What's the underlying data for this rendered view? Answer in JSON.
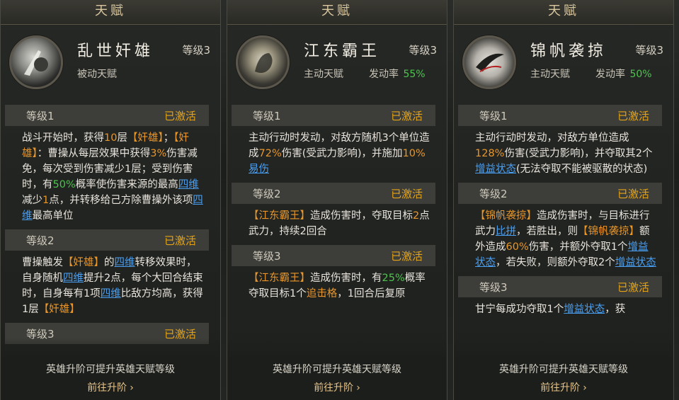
{
  "cards": [
    {
      "header": "天赋",
      "name": "乱世奸雄",
      "level": "等级3",
      "type": "被动天赋",
      "trigger_label": "",
      "trigger_value": "",
      "sections": [
        {
          "label": "等级1",
          "status": "已激活"
        },
        {
          "label": "等级2",
          "status": "已激活"
        },
        {
          "label": "等级3",
          "status": "已激活"
        }
      ],
      "footer_note": "英雄升阶可提升英雄天赋等级",
      "goto_label": "前往升阶"
    },
    {
      "header": "天赋",
      "name": "江东霸王",
      "level": "等级3",
      "type": "主动天赋",
      "trigger_label": "发动率",
      "trigger_value": "55%",
      "sections": [
        {
          "label": "等级1",
          "status": "已激活"
        },
        {
          "label": "等级2",
          "status": "已激活"
        },
        {
          "label": "等级3",
          "status": "已激活"
        }
      ],
      "footer_note": "英雄升阶可提升英雄天赋等级",
      "goto_label": "前往升阶"
    },
    {
      "header": "天赋",
      "name": "锦帆袭掠",
      "level": "等级3",
      "type": "主动天赋",
      "trigger_label": "发动率",
      "trigger_value": "50%",
      "sections": [
        {
          "label": "等级1",
          "status": "已激活"
        },
        {
          "label": "等级2",
          "status": "已激活"
        },
        {
          "label": "等级3",
          "status": "已激活"
        }
      ],
      "footer_note": "英雄升阶可提升英雄天赋等级",
      "goto_label": "前往升阶"
    }
  ],
  "text": {
    "c1": {
      "l1": [
        {
          "t": "战斗开始时，获得"
        },
        {
          "t": "10",
          "c": "orange"
        },
        {
          "t": "层"
        },
        {
          "t": "【奸雄】",
          "c": "orange"
        },
        {
          "t": "；"
        },
        {
          "t": "【奸雄】",
          "c": "orange"
        },
        {
          "t": "：曹操从每层效果中获得"
        },
        {
          "t": "3%",
          "c": "orange"
        },
        {
          "t": "伤害减免，每次受到伤害减少1层；受到伤害时，有"
        },
        {
          "t": "50%",
          "c": "green"
        },
        {
          "t": "概率使伤害来源的最高"
        },
        {
          "t": "四维",
          "c": "blue"
        },
        {
          "t": "减少"
        },
        {
          "t": "1",
          "c": "orange"
        },
        {
          "t": "点，并转移给己方除曹操外该项"
        },
        {
          "t": "四维",
          "c": "blue"
        },
        {
          "t": "最高单位"
        }
      ],
      "l2": [
        {
          "t": "曹操触发"
        },
        {
          "t": "【奸雄】",
          "c": "orange"
        },
        {
          "t": "的"
        },
        {
          "t": "四维",
          "c": "blue"
        },
        {
          "t": "转移效果时，自身随机"
        },
        {
          "t": "四维",
          "c": "blue"
        },
        {
          "t": "提升2点，每个大回合结束时，自身每有1项"
        },
        {
          "t": "四维",
          "c": "blue"
        },
        {
          "t": "比敌方均高，获得1层"
        },
        {
          "t": "【奸雄】",
          "c": "orange"
        }
      ],
      "l3": []
    },
    "c2": {
      "l1": [
        {
          "t": "主动行动时发动，对敌方随机3个单位造成"
        },
        {
          "t": "72%",
          "c": "orange"
        },
        {
          "t": "伤害(受武力影响)，并施加"
        },
        {
          "t": "10%",
          "c": "orange"
        },
        {
          "t": "易伤",
          "c": "blue"
        }
      ],
      "l2": [
        {
          "t": "【江东霸王】",
          "c": "orange"
        },
        {
          "t": "造成伤害时，夺取目标"
        },
        {
          "t": "2",
          "c": "orange"
        },
        {
          "t": "点武力，持续2回合"
        }
      ],
      "l3": [
        {
          "t": "【江东霸王】",
          "c": "orange"
        },
        {
          "t": "造成伤害时，有"
        },
        {
          "t": "25%",
          "c": "green"
        },
        {
          "t": "概率夺取目标1个"
        },
        {
          "t": "追击格",
          "c": "orange"
        },
        {
          "t": "，1回合后复原"
        }
      ]
    },
    "c3": {
      "l1": [
        {
          "t": "主动行动时发动，对敌方单位造成"
        },
        {
          "t": "128%",
          "c": "orange"
        },
        {
          "t": "伤害(受武力影响)，并夺取其2个"
        },
        {
          "t": "增益状态",
          "c": "blue"
        },
        {
          "t": "(无法夺取不能被驱散的状态)"
        }
      ],
      "l2": [
        {
          "t": "【锦帆袭掠】",
          "c": "orange"
        },
        {
          "t": "造成伤害时，与目标进行武力"
        },
        {
          "t": "比拼",
          "c": "blue"
        },
        {
          "t": "，若胜出，则"
        },
        {
          "t": "【锦帆袭掠】",
          "c": "orange"
        },
        {
          "t": "额外造成"
        },
        {
          "t": "60%",
          "c": "orange"
        },
        {
          "t": "伤害，并额外夺取1个"
        },
        {
          "t": "增益状态",
          "c": "blue"
        },
        {
          "t": "，若失败，则额外夺取2个"
        },
        {
          "t": "增益状态",
          "c": "blue"
        }
      ],
      "l3": [
        {
          "t": "甘宁每成功夺取1个"
        },
        {
          "t": "增益状态",
          "c": "blue"
        },
        {
          "t": "，获"
        }
      ]
    }
  }
}
